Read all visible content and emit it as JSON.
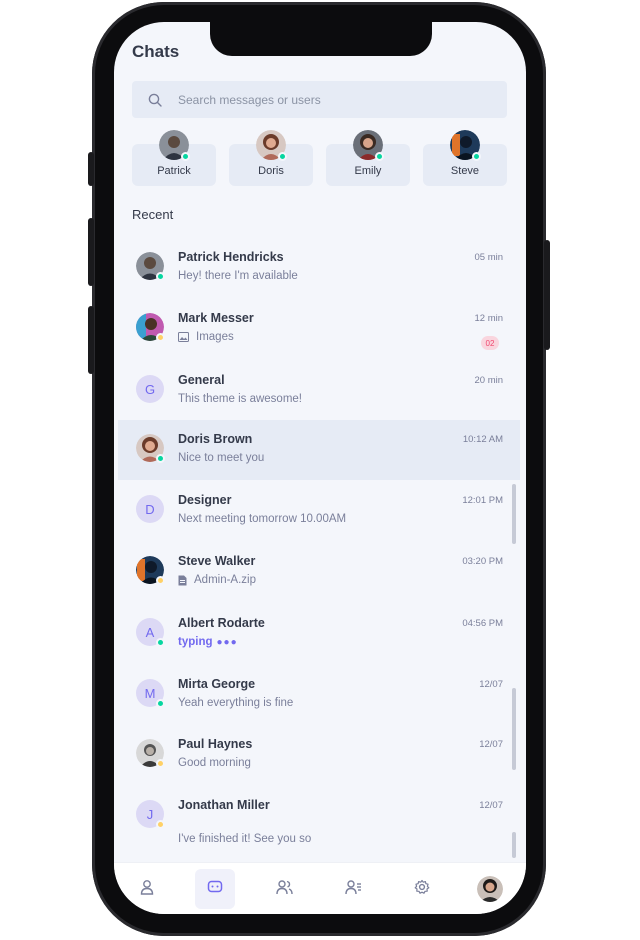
{
  "header": {
    "title": "Chats"
  },
  "search": {
    "placeholder": "Search messages or users"
  },
  "online_users": [
    {
      "name": "Patrick",
      "avatar_color": "#5b4a3f"
    },
    {
      "name": "Doris",
      "avatar_color": "#b06a5a"
    },
    {
      "name": "Emily",
      "avatar_color": "#8a2a2a"
    },
    {
      "name": "Steve",
      "avatar_color": "#1e3a5a"
    }
  ],
  "recent_label": "Recent",
  "chats": [
    {
      "name": "Patrick Hendricks",
      "message": "Hey! there I'm available",
      "time": "05 min",
      "status": "online"
    },
    {
      "name": "Mark Messer",
      "message": "Images",
      "time": "12 min",
      "unread": "02",
      "status": "away",
      "icon": "image-icon"
    },
    {
      "name": "General",
      "initial": "G",
      "message": "This theme is awesome!",
      "time": "20 min"
    },
    {
      "name": "Doris Brown",
      "message": "Nice to meet you",
      "time": "10:12 AM",
      "status": "online",
      "active": true
    },
    {
      "name": "Designer",
      "initial": "D",
      "message": "Next meeting tomorrow 10.00AM",
      "time": "12:01 PM"
    },
    {
      "name": "Steve Walker",
      "message": "Admin-A.zip",
      "time": "03:20 PM",
      "status": "away",
      "icon": "file-icon"
    },
    {
      "name": "Albert Rodarte",
      "initial": "A",
      "message": "typing",
      "time": "04:56 PM",
      "status": "online",
      "typing": true
    },
    {
      "name": "Mirta George",
      "initial": "M",
      "message": "Yeah everything is fine",
      "time": "12/07",
      "status": "online"
    },
    {
      "name": "Paul Haynes",
      "message": "Good morning",
      "time": "12/07",
      "status": "away"
    },
    {
      "name": "Jonathan Miller",
      "initial": "J",
      "message": "I've finished it! See you so",
      "time": "12/07",
      "status": "away"
    }
  ],
  "nav": [
    "profile-icon",
    "chat-icon",
    "group-icon",
    "contacts-icon",
    "settings-icon",
    "user-avatar"
  ],
  "colors": {
    "accent": "#7269ef",
    "online": "#06d6a0",
    "away": "#ffd166",
    "badge": "#ef476f"
  }
}
